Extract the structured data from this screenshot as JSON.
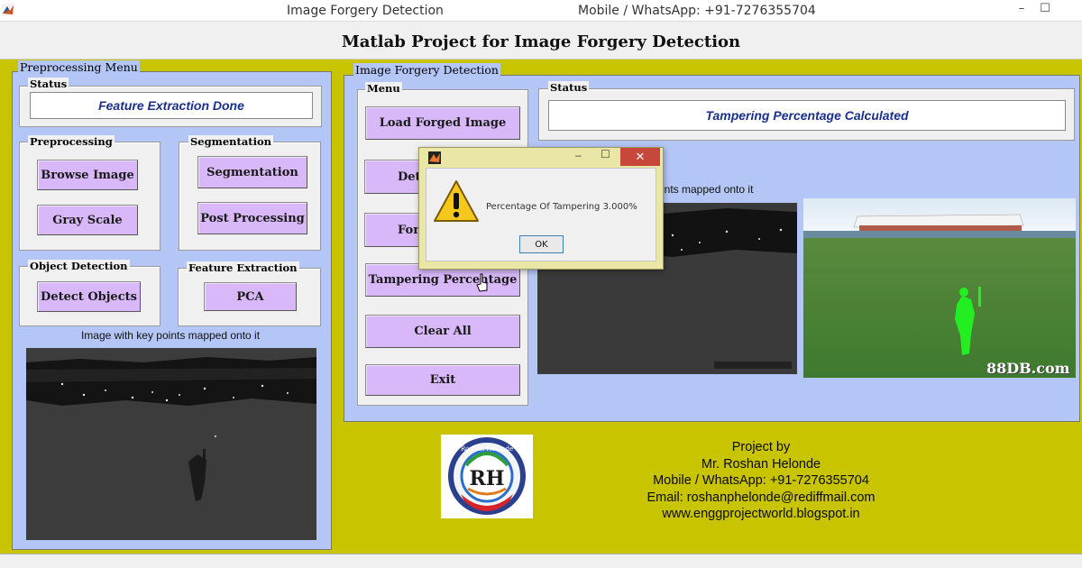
{
  "window": {
    "title": "Image Forgery Detection",
    "contact": "Mobile / WhatsApp: +91-7276355704",
    "min_glyph": "–",
    "max_glyph": "☐"
  },
  "page_title": "Matlab Project for Image Forgery Detection",
  "preprocessing_menu": {
    "title": "Preprocessing Menu",
    "status": {
      "title": "Status",
      "value": "Feature Extraction Done"
    },
    "preprocessing": {
      "title": "Preprocessing",
      "browse": "Browse Image",
      "gray": "Gray Scale"
    },
    "segmentation": {
      "title": "Segmentation",
      "segmentation": "Segmentation",
      "post": "Post Processing"
    },
    "object_detection": {
      "title": "Object Detection",
      "detect": "Detect Objects"
    },
    "feature_extraction": {
      "title": "Feature Extraction",
      "pca": "PCA"
    },
    "image_caption": "Image with key points mapped onto it"
  },
  "forgery_detection": {
    "title": "Image Forgery Detection",
    "menu": {
      "title": "Menu",
      "load": "Load Forged Image",
      "detect_partial": "Det",
      "forgery_partial": "For",
      "tampering": "Tampering Percentage",
      "clear": "Clear All",
      "exit": "Exit"
    },
    "status": {
      "title": "Status",
      "value": "Tampering Percentage Calculated"
    },
    "image_caption_partial": "ints mapped onto it",
    "watermark": "88DB.com"
  },
  "dialog": {
    "message": "Percentage Of Tampering 3.000%",
    "ok": "OK",
    "close_glyph": "✕",
    "min_glyph": "–",
    "max_glyph": "☐"
  },
  "credits": {
    "line1": "Project by",
    "line2": "Mr. Roshan Helonde",
    "line3": "Mobile / WhatsApp: +91-7276355704",
    "line4": "Email: roshanphelonde@rediffmail.com",
    "line5": "www.enggprojectworld.blogspot.in"
  },
  "logo": {
    "top_text": "Roshan Helonde",
    "letters": "RH"
  },
  "colors": {
    "background": "#c8c400",
    "panel": "#b4c6f6",
    "button": "#d8b8f8",
    "status_text": "#1a2f8a",
    "grass": "#3e7a2e",
    "highlight": "#22ee22"
  }
}
